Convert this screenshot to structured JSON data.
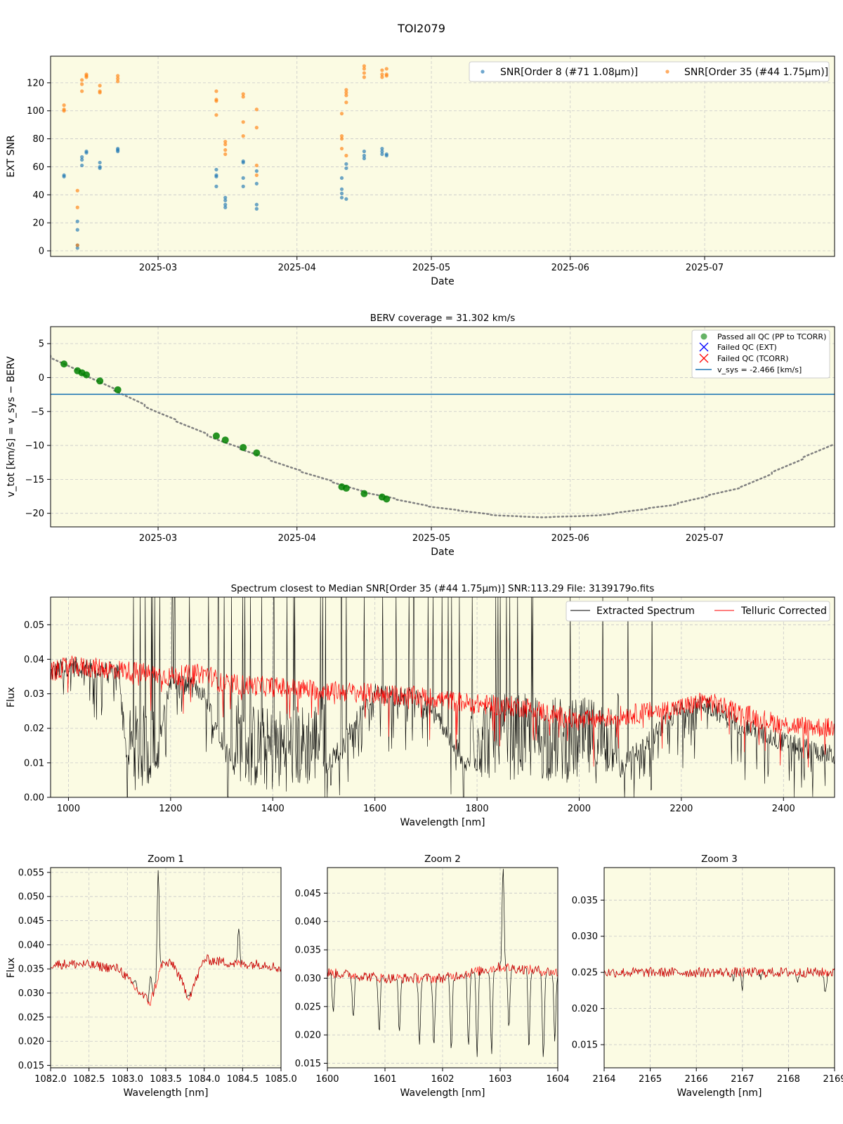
{
  "title": "TOI2079",
  "colors": {
    "plot_bg": "#fbfbe3",
    "grid": "#c8c8c8",
    "snr_order8": "#1f77b4",
    "snr_order35": "#ff7f0e",
    "passed": "#008000",
    "failed_ext": "#0000ff",
    "failed_tcorr": "#ff0000",
    "vsys": "#1f77b4",
    "model": "#808080",
    "extracted": "#000000",
    "telluric": "#ff0000"
  },
  "chart_data": [
    {
      "id": "snr",
      "type": "scatter",
      "title": "",
      "xlabel": "Date",
      "ylabel": "EXT SNR",
      "xlim": [
        "2025-02-05",
        "2025-07-30"
      ],
      "ylim": [
        -4,
        139
      ],
      "xticks": [
        "2025-03-01",
        "2025-04-01",
        "2025-05-01",
        "2025-06-01",
        "2025-07-01"
      ],
      "xtick_labels": [
        "2025-03",
        "2025-04",
        "2025-05",
        "2025-06",
        "2025-07"
      ],
      "yticks": [
        0,
        20,
        40,
        60,
        80,
        100,
        120
      ],
      "ytick_labels": [
        "0",
        "20",
        "40",
        "60",
        "80",
        "100",
        "120"
      ],
      "legend_position": "top-right",
      "series": [
        {
          "name": "SNR[Order 8 (#71 1.08μm)]",
          "color": "#1f77b4",
          "x": [
            "2025-02-08",
            "2025-02-08",
            "2025-02-11",
            "2025-02-11",
            "2025-02-11",
            "2025-02-11",
            "2025-02-12",
            "2025-02-12",
            "2025-02-12",
            "2025-02-13",
            "2025-02-13",
            "2025-02-16",
            "2025-02-16",
            "2025-02-16",
            "2025-02-20",
            "2025-02-20",
            "2025-02-20",
            "2025-03-14",
            "2025-03-14",
            "2025-03-14",
            "2025-03-14",
            "2025-03-16",
            "2025-03-16",
            "2025-03-16",
            "2025-03-16",
            "2025-03-20",
            "2025-03-20",
            "2025-03-20",
            "2025-03-20",
            "2025-03-23",
            "2025-03-23",
            "2025-03-23",
            "2025-03-23",
            "2025-04-11",
            "2025-04-11",
            "2025-04-11",
            "2025-04-11",
            "2025-04-12",
            "2025-04-12",
            "2025-04-12",
            "2025-04-16",
            "2025-04-16",
            "2025-04-16",
            "2025-04-20",
            "2025-04-20",
            "2025-04-20",
            "2025-04-21",
            "2025-04-21"
          ],
          "y": [
            53,
            54,
            2,
            15,
            21,
            4,
            61,
            65,
            67,
            71,
            70,
            59,
            60,
            63,
            71,
            72,
            73,
            53,
            54,
            46,
            58,
            31,
            33,
            36,
            38,
            46,
            52,
            63,
            64,
            30,
            33,
            48,
            57,
            38,
            41,
            44,
            52,
            37,
            59,
            62,
            66,
            68,
            71,
            69,
            71,
            73,
            68,
            69
          ]
        },
        {
          "name": "SNR[Order 35 (#44 1.75μm)]",
          "color": "#ff7f0e",
          "x": [
            "2025-02-08",
            "2025-02-08",
            "2025-02-08",
            "2025-02-11",
            "2025-02-11",
            "2025-02-11",
            "2025-02-12",
            "2025-02-12",
            "2025-02-12",
            "2025-02-13",
            "2025-02-13",
            "2025-02-13",
            "2025-02-16",
            "2025-02-16",
            "2025-02-16",
            "2025-02-20",
            "2025-02-20",
            "2025-02-20",
            "2025-03-14",
            "2025-03-14",
            "2025-03-14",
            "2025-03-14",
            "2025-03-16",
            "2025-03-16",
            "2025-03-16",
            "2025-03-16",
            "2025-03-20",
            "2025-03-20",
            "2025-03-20",
            "2025-03-20",
            "2025-03-23",
            "2025-03-23",
            "2025-03-23",
            "2025-03-23",
            "2025-04-11",
            "2025-04-11",
            "2025-04-11",
            "2025-04-11",
            "2025-04-12",
            "2025-04-12",
            "2025-04-12",
            "2025-04-12",
            "2025-04-12",
            "2025-04-16",
            "2025-04-16",
            "2025-04-16",
            "2025-04-16",
            "2025-04-20",
            "2025-04-20",
            "2025-04-20",
            "2025-04-21",
            "2025-04-21",
            "2025-04-21"
          ],
          "y": [
            100,
            101,
            104,
            43,
            31,
            4,
            114,
            119,
            122,
            124,
            125,
            126,
            113,
            114,
            118,
            121,
            123,
            125,
            97,
            107,
            108,
            114,
            69,
            72,
            76,
            78,
            82,
            92,
            110,
            112,
            88,
            101,
            54,
            61,
            73,
            80,
            82,
            98,
            68,
            106,
            111,
            113,
            115,
            124,
            127,
            130,
            132,
            124,
            126,
            129,
            125,
            126,
            130
          ]
        }
      ]
    },
    {
      "id": "berv",
      "type": "scatter",
      "title": "BERV coverage = 31.302 km/s",
      "xlabel": "Date",
      "ylabel": "v_tot [km/s] = v_sys − BERV",
      "xlim": [
        "2025-02-05",
        "2025-07-30"
      ],
      "ylim": [
        -22,
        7.5
      ],
      "xticks": [
        "2025-03-01",
        "2025-04-01",
        "2025-05-01",
        "2025-06-01",
        "2025-07-01"
      ],
      "xtick_labels": [
        "2025-03",
        "2025-04",
        "2025-05",
        "2025-06",
        "2025-07"
      ],
      "yticks": [
        5,
        0,
        -5,
        -10,
        -15,
        -20
      ],
      "ytick_labels": [
        "5",
        "0",
        "−5",
        "−10",
        "−15",
        "−20"
      ],
      "vsys": -2.466,
      "legend_position": "top-right",
      "legend": [
        "Passed all QC (PP to TCORR)",
        "Failed QC (EXT)",
        "Failed QC (TCORR)",
        "v_sys = -2.466 [km/s]"
      ],
      "points": {
        "x": [
          "2025-02-08",
          "2025-02-11",
          "2025-02-12",
          "2025-02-13",
          "2025-02-16",
          "2025-02-20",
          "2025-03-14",
          "2025-03-16",
          "2025-03-20",
          "2025-03-23",
          "2025-04-11",
          "2025-04-12",
          "2025-04-16",
          "2025-04-20",
          "2025-04-21"
        ],
        "y": [
          2.0,
          1.0,
          0.7,
          0.4,
          -0.5,
          -1.8,
          -8.6,
          -9.2,
          -10.3,
          -11.1,
          -16.1,
          -16.3,
          -17.1,
          -17.6,
          -17.9
        ]
      },
      "model_curve": {
        "x": [
          "2025-02-05",
          "2025-02-20",
          "2025-03-01",
          "2025-03-16",
          "2025-04-01",
          "2025-04-16",
          "2025-05-01",
          "2025-05-16",
          "2025-05-26",
          "2025-06-08",
          "2025-06-24",
          "2025-07-10",
          "2025-07-30"
        ],
        "y": [
          3.2,
          -1.9,
          -5.0,
          -9.5,
          -13.5,
          -16.8,
          -19.0,
          -20.3,
          -20.6,
          -20.3,
          -18.8,
          -16.1,
          -9.8
        ]
      }
    },
    {
      "id": "spectrum",
      "type": "line",
      "title": "Spectrum closest to Median SNR[Order 35 (#44 1.75μm)]      SNR:113.29      File: 3139179o.fits",
      "xlabel": "Wavelength [nm]",
      "ylabel": "Flux",
      "xlim": [
        965,
        2500
      ],
      "ylim": [
        0,
        0.058
      ],
      "xticks": [
        1000,
        1200,
        1400,
        1600,
        1800,
        2000,
        2200,
        2400
      ],
      "xtick_labels": [
        "1000",
        "1200",
        "1400",
        "1600",
        "1800",
        "2000",
        "2200",
        "2400"
      ],
      "yticks": [
        0,
        0.01,
        0.02,
        0.03,
        0.04,
        0.05
      ],
      "ytick_labels": [
        "0.00",
        "0.01",
        "0.02",
        "0.03",
        "0.04",
        "0.05"
      ],
      "legend_position": "top-right",
      "series": [
        {
          "name": "Extracted Spectrum",
          "color": "#000000",
          "x": [
            965,
            1000,
            1100,
            1120,
            1160,
            1200,
            1260,
            1340,
            1400,
            1480,
            1600,
            1700,
            1800,
            1900,
            1990,
            2050,
            2200,
            2250,
            2300,
            2400,
            2500
          ],
          "y": [
            0.036,
            0.038,
            0.036,
            0.002,
            0.002,
            0.034,
            0.031,
            0.003,
            0.001,
            0.003,
            0.03,
            0.028,
            0.005,
            0.005,
            0.004,
            0.004,
            0.026,
            0.027,
            0.022,
            0.016,
            0.012
          ]
        },
        {
          "name": "Telluric Corrected",
          "color": "#ff0000",
          "x": [
            965,
            1000,
            1100,
            1200,
            1270,
            1300,
            1400,
            1500,
            1600,
            1700,
            1800,
            1900,
            1950,
            2000,
            2100,
            2200,
            2250,
            2300,
            2400,
            2500
          ],
          "y": [
            0.036,
            0.038,
            0.037,
            0.035,
            0.036,
            0.033,
            0.032,
            0.031,
            0.03,
            0.029,
            0.027,
            0.026,
            0.024,
            0.022,
            0.024,
            0.026,
            0.028,
            0.025,
            0.021,
            0.02
          ]
        }
      ]
    },
    {
      "id": "zoom1",
      "type": "line",
      "title": "Zoom 1",
      "xlabel": "Wavelength [nm]",
      "ylabel": "Flux",
      "xlim": [
        1082.0,
        1085.0
      ],
      "ylim": [
        0.0145,
        0.056
      ],
      "xticks": [
        1082.0,
        1082.5,
        1083.0,
        1083.5,
        1084.0,
        1084.5,
        1085.0
      ],
      "xtick_labels": [
        "1082.0",
        "1082.5",
        "1083.0",
        "1083.5",
        "1084.0",
        "1084.5",
        "1085.0"
      ],
      "yticks": [
        0.015,
        0.02,
        0.025,
        0.03,
        0.035,
        0.04,
        0.045,
        0.05,
        0.055
      ],
      "ytick_labels": [
        "0.015",
        "0.020",
        "0.025",
        "0.030",
        "0.035",
        "0.040",
        "0.045",
        "0.050",
        "0.055"
      ],
      "series": [
        {
          "name": "Extracted Spectrum",
          "color": "#000000",
          "x": [
            1082.0,
            1082.4,
            1082.9,
            1083.1,
            1083.3,
            1083.4,
            1083.45,
            1083.6,
            1083.8,
            1084.0,
            1084.4,
            1084.45,
            1084.5,
            1084.8,
            1085.0
          ],
          "y": [
            0.036,
            0.036,
            0.035,
            0.033,
            0.034,
            0.056,
            0.036,
            0.036,
            0.03,
            0.037,
            0.036,
            0.043,
            0.036,
            0.036,
            0.035
          ]
        },
        {
          "name": "Telluric Corrected",
          "color": "#ff0000",
          "x": [
            1082.0,
            1082.4,
            1082.9,
            1083.1,
            1083.3,
            1083.45,
            1083.6,
            1083.8,
            1084.0,
            1084.45,
            1084.8,
            1085.0
          ],
          "y": [
            0.036,
            0.036,
            0.035,
            0.031,
            0.028,
            0.036,
            0.036,
            0.029,
            0.037,
            0.036,
            0.036,
            0.035
          ]
        }
      ]
    },
    {
      "id": "zoom2",
      "type": "line",
      "title": "Zoom 2",
      "xlabel": "Wavelength [nm]",
      "ylabel": "",
      "xlim": [
        1600,
        1604
      ],
      "ylim": [
        0.0142,
        0.0495
      ],
      "xticks": [
        1600,
        1601,
        1602,
        1603,
        1604
      ],
      "xtick_labels": [
        "1600",
        "1601",
        "1602",
        "1603",
        "1604"
      ],
      "yticks": [
        0.015,
        0.02,
        0.025,
        0.03,
        0.035,
        0.04,
        0.045
      ],
      "ytick_labels": [
        "0.015",
        "0.020",
        "0.025",
        "0.030",
        "0.035",
        "0.040",
        "0.045"
      ],
      "series": [
        {
          "name": "Extracted Spectrum",
          "color": "#000000",
          "x": [
            1600.1,
            1600.45,
            1600.9,
            1601.25,
            1601.6,
            1601.85,
            1602.15,
            1602.45,
            1602.6,
            1602.85,
            1603.05,
            1603.15,
            1603.5,
            1603.75,
            1603.95
          ],
          "y": [
            0.024,
            0.023,
            0.021,
            0.02,
            0.019,
            0.018,
            0.017,
            0.018,
            0.016,
            0.017,
            0.05,
            0.021,
            0.018,
            0.016,
            0.019
          ]
        },
        {
          "name": "Telluric Corrected",
          "color": "#ff0000",
          "x": [
            1600.0,
            1601.0,
            1602.0,
            1603.0,
            1604.0
          ],
          "y": [
            0.031,
            0.03,
            0.03,
            0.032,
            0.031
          ]
        }
      ]
    },
    {
      "id": "zoom3",
      "type": "line",
      "title": "Zoom 3",
      "xlabel": "Wavelength [nm]",
      "ylabel": "",
      "xlim": [
        2164,
        2169
      ],
      "ylim": [
        0.0118,
        0.0395
      ],
      "xticks": [
        2164,
        2165,
        2166,
        2167,
        2168,
        2169
      ],
      "xtick_labels": [
        "2164",
        "2165",
        "2166",
        "2167",
        "2168",
        "2169"
      ],
      "yticks": [
        0.015,
        0.02,
        0.025,
        0.03,
        0.035
      ],
      "ytick_labels": [
        "0.015",
        "0.020",
        "0.025",
        "0.030",
        "0.035"
      ],
      "series": [
        {
          "name": "Extracted Spectrum",
          "color": "#000000",
          "x": [
            2164.0,
            2165.5,
            2166.8,
            2167.0,
            2167.4,
            2168.2,
            2168.8,
            2169.0
          ],
          "y": [
            0.025,
            0.025,
            0.024,
            0.023,
            0.024,
            0.024,
            0.022,
            0.025
          ]
        },
        {
          "name": "Telluric Corrected",
          "color": "#ff0000",
          "x": [
            2164.0,
            2165.0,
            2166.0,
            2167.0,
            2168.0,
            2169.0
          ],
          "y": [
            0.025,
            0.025,
            0.025,
            0.025,
            0.025,
            0.025
          ]
        }
      ]
    }
  ]
}
